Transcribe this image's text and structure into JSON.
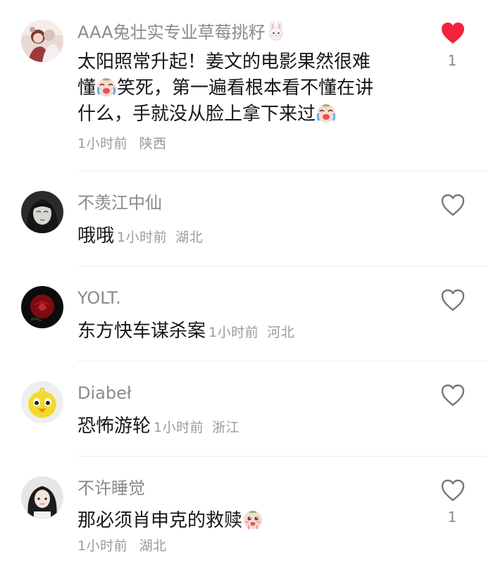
{
  "comments": [
    {
      "username": "AAA兔壮实专业草莓挑籽",
      "username_emoji": "rabbit-face-icon",
      "text_lines": [
        "太阳照常升起！姜文的电影果然很难",
        "懂",
        "笑死，第一遍看根本看不懂在讲",
        "什么，手就没从脸上拿下来过"
      ],
      "time": "1小时前",
      "location": "陕西",
      "liked": true,
      "like_count": "1",
      "heart_color": "#f5223d"
    },
    {
      "username": "不羡江中仙",
      "text": "哦哦",
      "time": "1小时前",
      "location": "湖北",
      "liked": false
    },
    {
      "username": "YOLT.",
      "text": "东方快车谋杀案",
      "time": "1小时前",
      "location": "河北",
      "liked": false
    },
    {
      "username": "Diabeł",
      "text": "恐怖游轮",
      "time": "1小时前",
      "location": "浙江",
      "liked": false
    },
    {
      "username": "不许睡觉",
      "text": "那必须肖申克的救赎",
      "time": "1小时前",
      "location": "湖北",
      "liked": false,
      "like_count": "1"
    }
  ]
}
